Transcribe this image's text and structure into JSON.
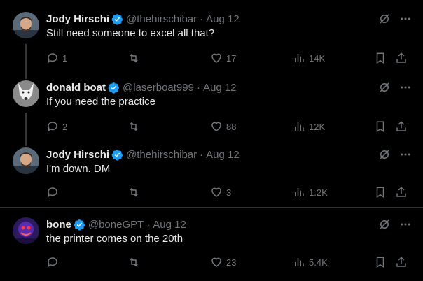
{
  "tweets": [
    {
      "name": "Jody Hirschi",
      "handle": "@thehirschibar",
      "date": "Aug 12",
      "text": "Still need someone to excel all that?",
      "replies": "1",
      "retweets": "",
      "likes": "17",
      "views": "14K"
    },
    {
      "name": "donald boat",
      "handle": "@laserboat999",
      "date": "Aug 12",
      "text": "If you need the practice",
      "replies": "2",
      "retweets": "",
      "likes": "88",
      "views": "12K"
    },
    {
      "name": "Jody Hirschi",
      "handle": "@thehirschibar",
      "date": "Aug 12",
      "text": "I'm down. DM",
      "replies": "",
      "retweets": "",
      "likes": "3",
      "views": "1.2K"
    },
    {
      "name": "bone",
      "handle": "@boneGPT",
      "date": "Aug 12",
      "text": "the printer comes on the 20th",
      "replies": "",
      "retweets": "",
      "likes": "23",
      "views": "5.4K"
    }
  ],
  "separator": "·",
  "colors": {
    "background": "#000000",
    "text": "#e7e9ea",
    "muted": "#71767b",
    "verified": "#1d9bf0",
    "divider": "#2f3336"
  },
  "icons": [
    "reply-icon",
    "retweet-icon",
    "like-icon",
    "views-icon",
    "bookmark-icon",
    "share-icon",
    "grok-icon",
    "more-icon",
    "verified-icon"
  ]
}
